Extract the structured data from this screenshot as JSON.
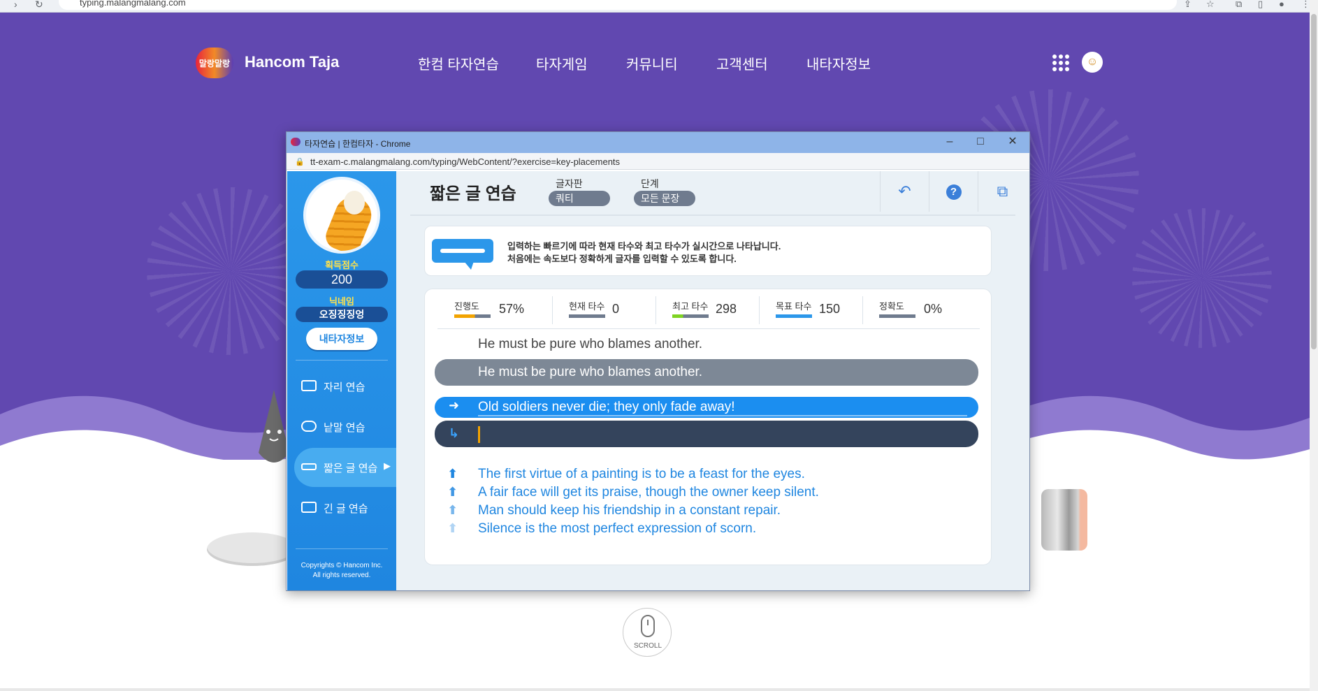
{
  "browser": {
    "url": "typing.malangmalang.com"
  },
  "site": {
    "logo_badge": "말랑말랑",
    "logo_text": "Hancom Taja",
    "nav": [
      "한컴 타자연습",
      "타자게임",
      "커뮤니티",
      "고객센터",
      "내타자정보"
    ],
    "scroll_label": "SCROLL"
  },
  "popup": {
    "title": "타자연습 | 한컴타자 - Chrome",
    "url": "tt-exam-c.malangmalang.com/typing/WebContent/?exercise=key-placements",
    "sidebar": {
      "score_label": "획득점수",
      "score_value": "200",
      "nickname_label": "닉네임",
      "nickname_value": "오징징징엉",
      "info_button": "내타자정보",
      "menu": [
        {
          "label": "자리 연습",
          "icon": "keyboard-icon"
        },
        {
          "label": "낱말 연습",
          "icon": "speech-bubble-icon"
        },
        {
          "label": "짧은 글 연습",
          "icon": "short-text-icon",
          "active": true
        },
        {
          "label": "긴 글 연습",
          "icon": "long-text-icon"
        }
      ],
      "copyright_line1": "Copyrights © Hancom Inc.",
      "copyright_line2": "All rights reserved."
    },
    "header": {
      "title": "짧은 글 연습",
      "keyboard_label": "글자판",
      "keyboard_value": "쿼티",
      "level_label": "단계",
      "level_value": "모든 문장",
      "back_icon": "undo-icon",
      "help_icon": "help-icon",
      "window_icon": "popout-icon"
    },
    "notice": {
      "line1": "입력하는 빠르기에 따라 현재 타수와 최고 타수가 실시간으로 나타납니다.",
      "line2": "처음에는 속도보다 정확하게 글자를 입력할 수 있도록 합니다."
    },
    "stats": [
      {
        "label": "진행도",
        "value": "57%",
        "progress": 0.57
      },
      {
        "label": "현재 타수",
        "value": "0",
        "progress": 0
      },
      {
        "label": "최고 타수",
        "value": "298",
        "progress": 0.3
      },
      {
        "label": "목표 타수",
        "value": "150",
        "progress": 1
      },
      {
        "label": "정확도",
        "value": "0%",
        "progress": 0
      }
    ],
    "practice": {
      "previous_sentence": "He must be pure who blames another.",
      "typed_sentence": "He must be pure who blames another.",
      "current_sentence": "Old soldiers never die; they only fade away!",
      "input_value": "",
      "upcoming": [
        "The first virtue of a painting is to be a feast for the eyes.",
        "A fair face will get its praise, though the owner keep silent.",
        "Man should keep his friendship in a constant repair.",
        "Silence is the most perfect expression of scorn."
      ]
    }
  },
  "colors": {
    "hero_purple": "#6148b0",
    "sidebar_blue": "#1f86e0",
    "current_row_blue": "#1b8ef0",
    "input_row_navy": "#34445c"
  }
}
